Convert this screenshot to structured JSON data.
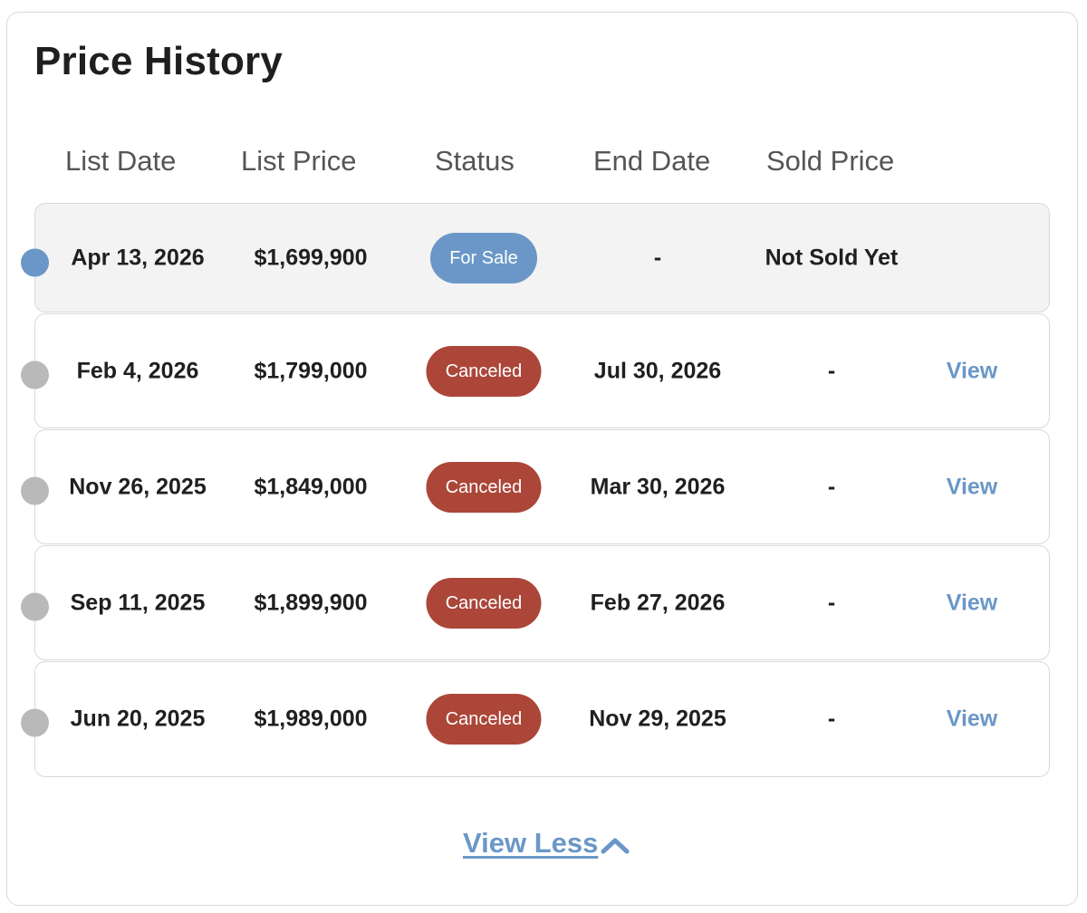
{
  "title": "Price History",
  "columns": [
    "List Date",
    "List Price",
    "Status",
    "End Date",
    "Sold Price"
  ],
  "rows": [
    {
      "list_date": "Apr 13, 2026",
      "list_price": "$1,699,900",
      "status": "For Sale",
      "status_type": "for-sale",
      "end_date": "-",
      "sold_price": "Not Sold Yet",
      "action": "",
      "current": true
    },
    {
      "list_date": "Feb 4, 2026",
      "list_price": "$1,799,000",
      "status": "Canceled",
      "status_type": "canceled",
      "end_date": "Jul 30, 2026",
      "sold_price": "-",
      "action": "View",
      "current": false
    },
    {
      "list_date": "Nov 26, 2025",
      "list_price": "$1,849,000",
      "status": "Canceled",
      "status_type": "canceled",
      "end_date": "Mar 30, 2026",
      "sold_price": "-",
      "action": "View",
      "current": false
    },
    {
      "list_date": "Sep 11, 2025",
      "list_price": "$1,899,900",
      "status": "Canceled",
      "status_type": "canceled",
      "end_date": "Feb 27, 2026",
      "sold_price": "-",
      "action": "View",
      "current": false
    },
    {
      "list_date": "Jun 20, 2025",
      "list_price": "$1,989,000",
      "status": "Canceled",
      "status_type": "canceled",
      "end_date": "Nov 29, 2025",
      "sold_price": "-",
      "action": "View",
      "current": false
    }
  ],
  "footer": {
    "view_less_label": "View Less",
    "icon": "chevron-up-icon"
  },
  "colors": {
    "for_sale": "#6a97c7",
    "canceled": "#ab4639",
    "link": "#6a97c7",
    "timeline_active": "#6a97c7",
    "timeline_inactive": "#b9b9b9"
  }
}
